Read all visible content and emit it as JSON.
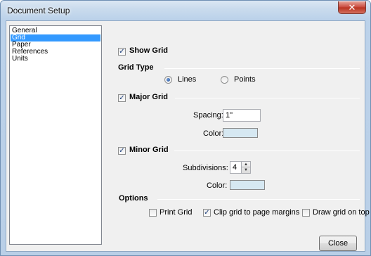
{
  "window": {
    "title": "Document Setup",
    "close_glyph": "✕"
  },
  "sidebar": {
    "items": [
      {
        "label": "General",
        "selected": false
      },
      {
        "label": "Grid",
        "selected": true
      },
      {
        "label": "Paper",
        "selected": false
      },
      {
        "label": "References",
        "selected": false
      },
      {
        "label": "Units",
        "selected": false
      }
    ]
  },
  "grid": {
    "show_grid": {
      "label": "Show Grid",
      "checked": true
    },
    "grid_type": {
      "heading": "Grid Type",
      "options": [
        {
          "label": "Lines",
          "selected": true
        },
        {
          "label": "Points",
          "selected": false
        }
      ]
    },
    "major": {
      "label": "Major Grid",
      "checked": true,
      "spacing_label": "Spacing:",
      "spacing_value": "1\"",
      "color_label": "Color:",
      "color": "#d6e8f2"
    },
    "minor": {
      "label": "Minor Grid",
      "checked": true,
      "subdivisions_label": "Subdivisions:",
      "subdivisions_value": "4",
      "color_label": "Color:",
      "color": "#d6e8f2"
    },
    "options": {
      "heading": "Options",
      "print_grid": {
        "label": "Print Grid",
        "checked": false
      },
      "clip_grid": {
        "label": "Clip grid to page margins",
        "checked": true
      },
      "draw_on_top": {
        "label": "Draw grid on top",
        "checked": false
      }
    }
  },
  "buttons": {
    "close_label": "Close"
  },
  "icons": {
    "check_glyph": "✓",
    "spin_up": "▲",
    "spin_down": "▼"
  }
}
